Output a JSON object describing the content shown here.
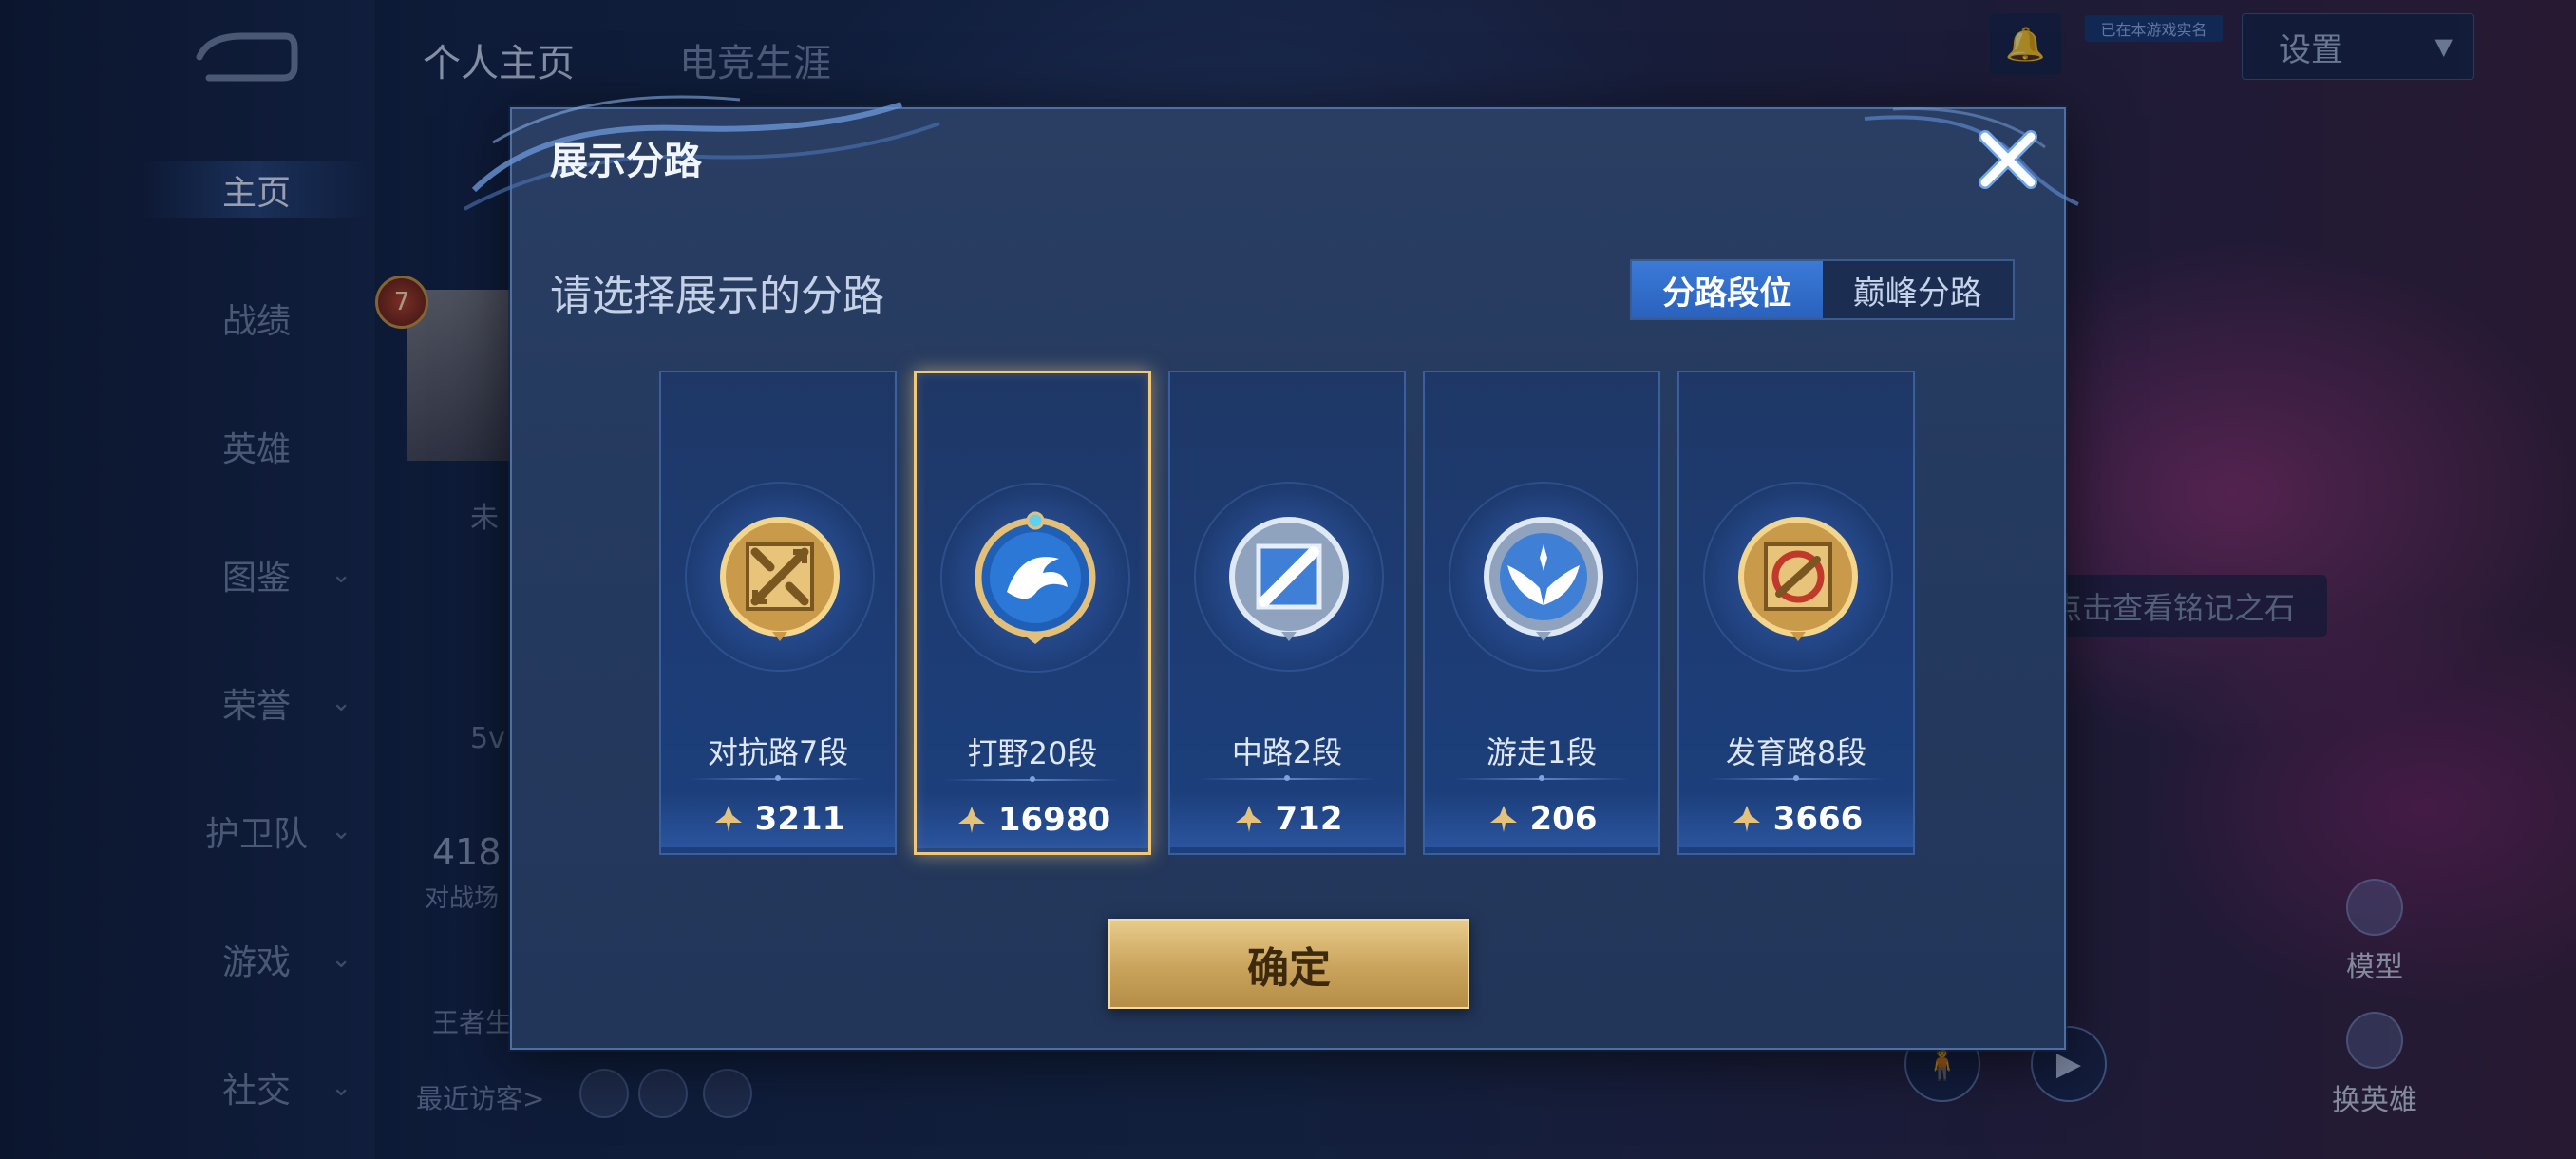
{
  "sidebar": {
    "items": [
      {
        "label": "主页",
        "has_chevron": false,
        "active": true
      },
      {
        "label": "战绩",
        "has_chevron": false,
        "active": false
      },
      {
        "label": "英雄",
        "has_chevron": false,
        "active": false
      },
      {
        "label": "图鉴",
        "has_chevron": true,
        "active": false
      },
      {
        "label": "荣誉",
        "has_chevron": true,
        "active": false
      },
      {
        "label": "护卫队",
        "has_chevron": true,
        "active": false
      },
      {
        "label": "游戏",
        "has_chevron": true,
        "active": false
      },
      {
        "label": "社交",
        "has_chevron": true,
        "active": false
      }
    ],
    "chevron_glyph": "⌄"
  },
  "header": {
    "tabs": [
      {
        "label": "个人主页",
        "active": true
      },
      {
        "label": "电竞生涯",
        "active": false
      }
    ],
    "settings_label": "设置",
    "tag_label": "已在本游戏实名"
  },
  "background_texts": {
    "level": "7",
    "partial_1": "未",
    "mode": "5v",
    "count": "418",
    "count_label": "对战场",
    "honor": "王者生",
    "visitors": "最近访客>",
    "rune_hint": "点击查看铭记之石",
    "model_label": "模型",
    "switch_hero_label": "换英雄"
  },
  "dialog": {
    "title": "展示分路",
    "subtitle": "请选择展示的分路",
    "close_glyph": "✕",
    "toggle": [
      {
        "label": "分路段位",
        "active": true
      },
      {
        "label": "巅峰分路",
        "active": false
      }
    ],
    "lanes": [
      {
        "label": "对抗路7段",
        "score": "3211",
        "emblem": "clash-lane-icon",
        "selected": false
      },
      {
        "label": "打野20段",
        "score": "16980",
        "emblem": "jungle-dragon-icon",
        "selected": true
      },
      {
        "label": "中路2段",
        "score": "712",
        "emblem": "mid-lane-icon",
        "selected": false
      },
      {
        "label": "游走1段",
        "score": "206",
        "emblem": "roam-wings-icon",
        "selected": false
      },
      {
        "label": "发育路8段",
        "score": "3666",
        "emblem": "farm-lane-icon",
        "selected": false
      }
    ],
    "confirm_label": "确定"
  },
  "colors": {
    "accent_gold": "#f0c879",
    "toggle_active": "#3b7ad8",
    "dialog_bg": "#253a5f"
  }
}
